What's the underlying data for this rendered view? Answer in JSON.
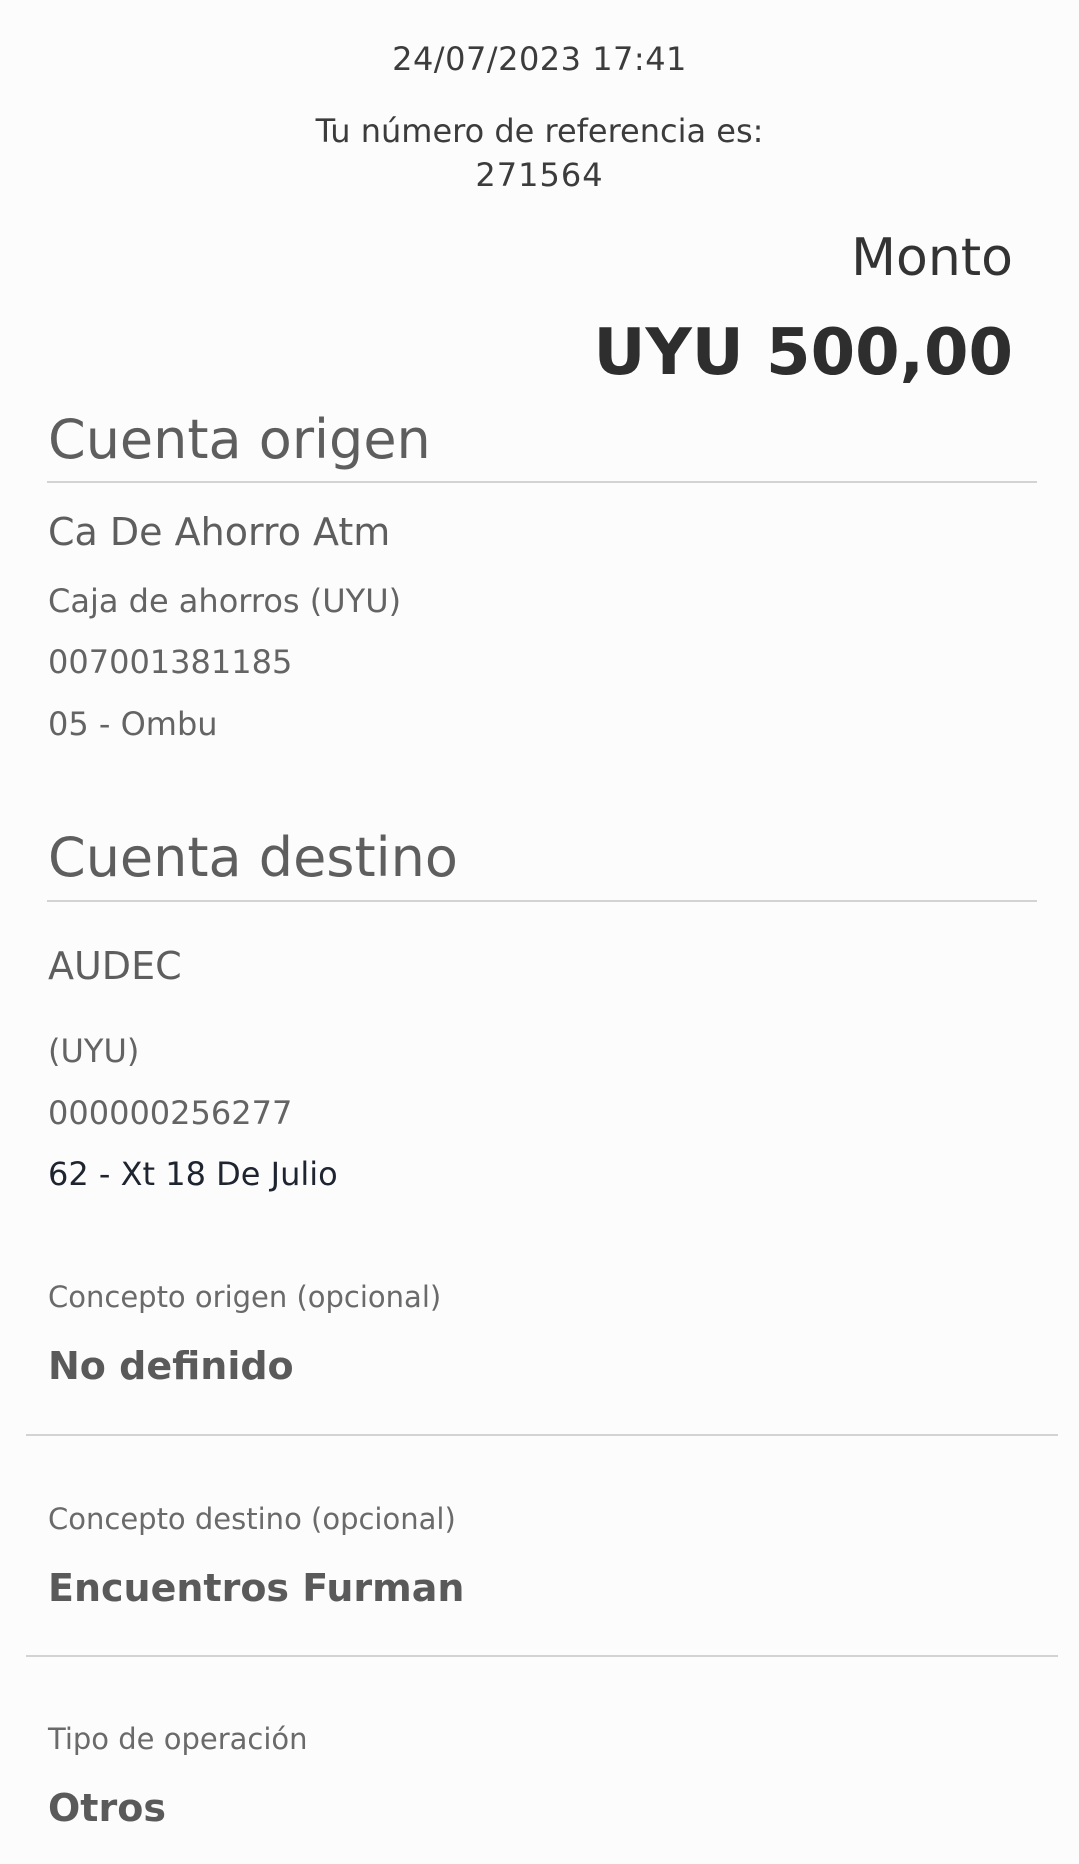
{
  "header": {
    "datetime": "24/07/2023 17:41",
    "reference_label": "Tu número de referencia es:",
    "reference_number": "271564"
  },
  "amount": {
    "label": "Monto",
    "value": "UYU 500,00"
  },
  "origin": {
    "title": "Cuenta origen",
    "name": "Ca De Ahorro Atm",
    "type": "Caja de ahorros (UYU)",
    "number": "007001381185",
    "branch": "05 - Ombu"
  },
  "destination": {
    "title": "Cuenta destino",
    "name": "AUDEC",
    "currency": "(UYU)",
    "number": "000000256277",
    "branch": "62 - Xt 18 De Julio"
  },
  "fields": {
    "concepto_origen_label": "Concepto origen (opcional)",
    "concepto_origen_value": "No definido",
    "concepto_destino_label": "Concepto destino (opcional)",
    "concepto_destino_value": "Encuentros Furman",
    "tipo_operacion_label": "Tipo de operación",
    "tipo_operacion_value": "Otros"
  }
}
